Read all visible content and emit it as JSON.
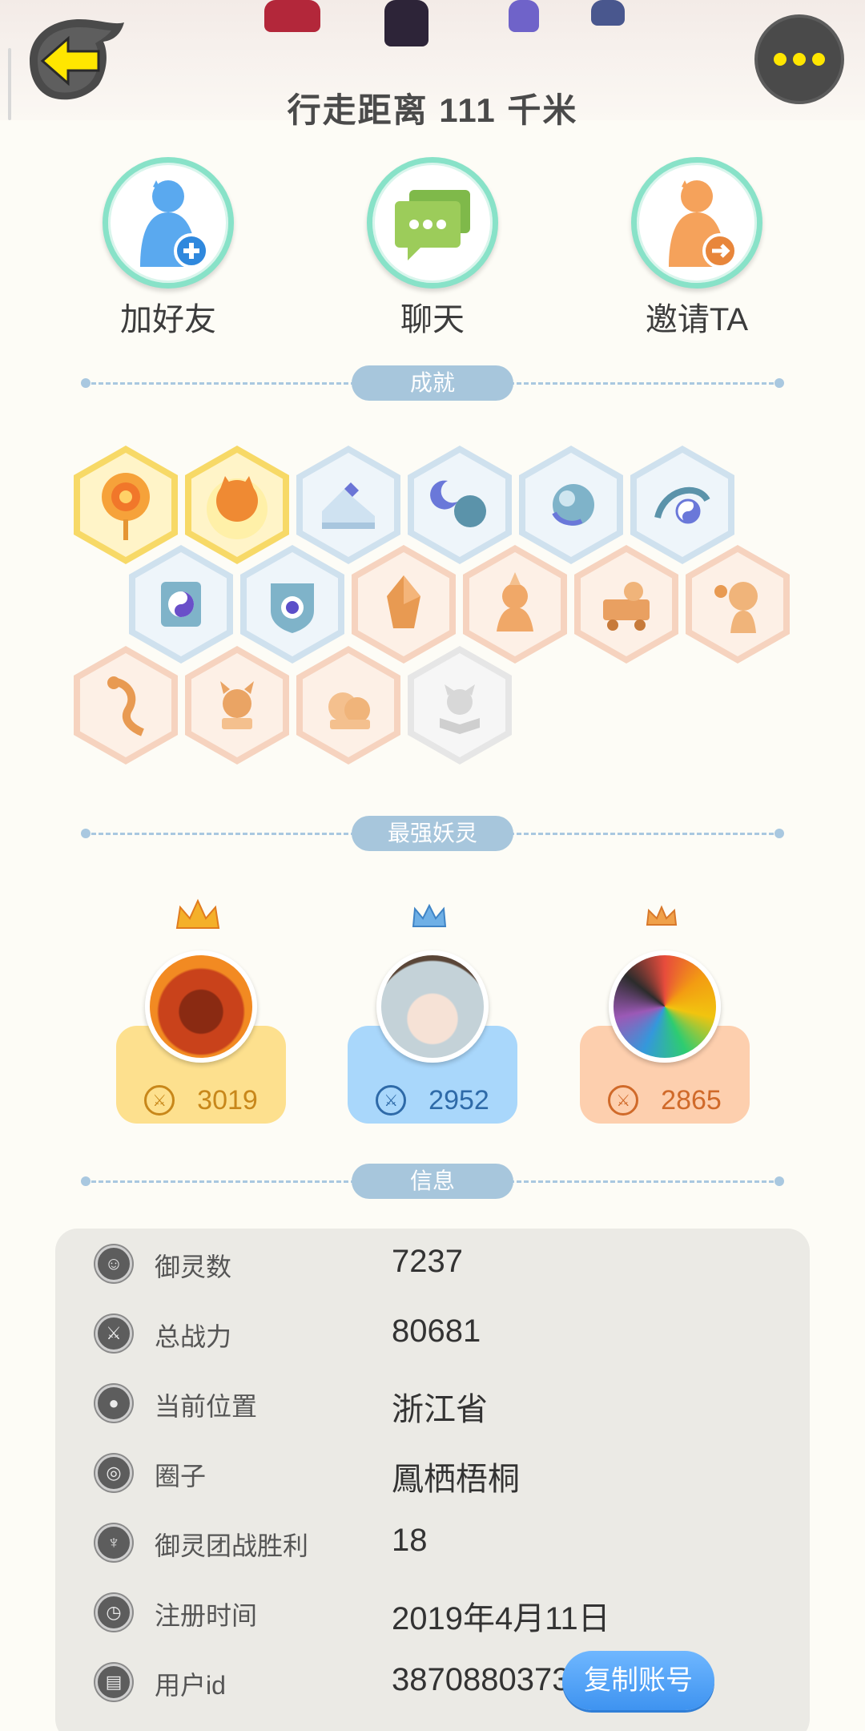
{
  "header": {
    "walk_distance": "行走距离 111 千米"
  },
  "actions": [
    {
      "label": "加好友",
      "icon": "add-friend-icon"
    },
    {
      "label": "聊天",
      "icon": "chat-icon"
    },
    {
      "label": "邀请TA",
      "icon": "invite-icon"
    }
  ],
  "sections": {
    "achievements": "成就",
    "top_spirits": "最强妖灵",
    "info": "信息"
  },
  "achievements": {
    "badges": [
      {
        "tier": "gold",
        "icon": "sun-pendulum-icon"
      },
      {
        "tier": "gold",
        "icon": "moon-cat-icon"
      },
      {
        "tier": "blue",
        "icon": "sneaker-icon"
      },
      {
        "tier": "blue",
        "icon": "moon-ball-icon"
      },
      {
        "tier": "blue",
        "icon": "orb-icon"
      },
      {
        "tier": "blue",
        "icon": "yinyang-wave-icon"
      },
      {
        "tier": "blue",
        "icon": "yinyang-book-icon"
      },
      {
        "tier": "blue",
        "icon": "shield-icon"
      },
      {
        "tier": "orange",
        "icon": "crystal-icon"
      },
      {
        "tier": "orange",
        "icon": "fire-spirit-icon"
      },
      {
        "tier": "orange",
        "icon": "cat-cart-icon"
      },
      {
        "tier": "orange",
        "icon": "cat-flower-icon"
      },
      {
        "tier": "orange",
        "icon": "dragon-icon"
      },
      {
        "tier": "orange",
        "icon": "horned-cat-icon"
      },
      {
        "tier": "orange",
        "icon": "cat-pair-icon"
      },
      {
        "tier": "gray",
        "icon": "fox-book-icon"
      }
    ]
  },
  "top_spirits": [
    {
      "power": "3019",
      "card_color": "#fde08e",
      "text_color": "#c8871a",
      "avatar": "fire-lion-avatar",
      "crown": "gold-crown-icon"
    },
    {
      "power": "2952",
      "card_color": "#a9d7fb",
      "text_color": "#2e6aa8",
      "avatar": "silver-hair-girl-avatar",
      "crown": "blue-crown-icon"
    },
    {
      "power": "2865",
      "card_color": "#fdcfae",
      "text_color": "#d06a2a",
      "avatar": "rainbow-spike-avatar",
      "crown": "orange-crown-icon"
    }
  ],
  "info": {
    "rows": [
      {
        "label": "御灵数",
        "value": "7237",
        "icon": "spirit-count-icon"
      },
      {
        "label": "总战力",
        "value": "80681",
        "icon": "sword-icon"
      },
      {
        "label": "当前位置",
        "value": "浙江省",
        "icon": "location-pin-icon"
      },
      {
        "label": "圈子",
        "value": "鳳栖梧桐",
        "icon": "circle-target-icon"
      },
      {
        "label": "御灵团战胜利",
        "value": "18",
        "icon": "team-battle-icon"
      },
      {
        "label": "注册时间",
        "value": "2019年4月11日",
        "icon": "clock-icon"
      },
      {
        "label": "用户id",
        "value": "38708803738",
        "icon": "id-card-icon"
      }
    ],
    "copy_button": "复制账号"
  },
  "colors": {
    "background": "#fdfcf6",
    "pill": "#a7c6dc",
    "accent_yellow": "#ffe600",
    "copy_button": "#4fa2f7"
  }
}
